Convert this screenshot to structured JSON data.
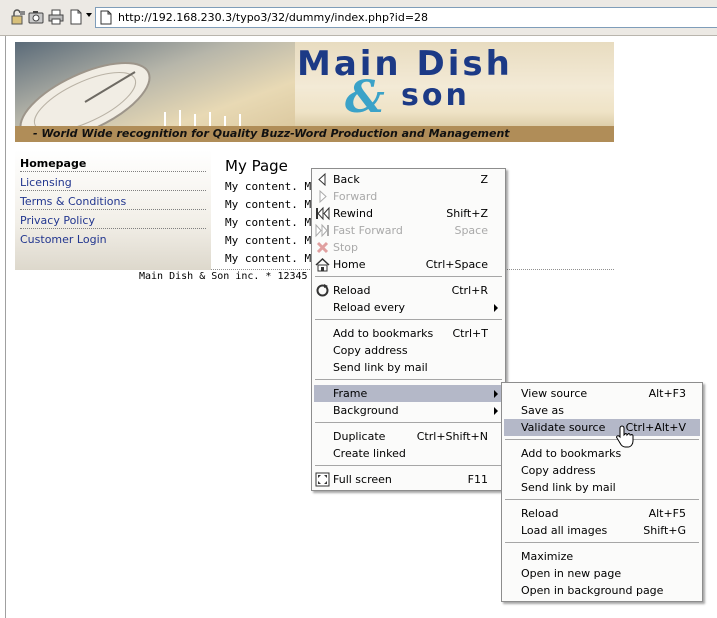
{
  "toolbar": {
    "address_url": "http://192.168.230.3/typo3/32/dummy/index.php?id=28",
    "icons": [
      "security-lock-icon",
      "camera-icon",
      "print-icon",
      "page-icon",
      "dropdown-arrow-icon"
    ]
  },
  "banner": {
    "title_main": "Main Dish",
    "title_amp": "&",
    "title_son": "son",
    "tagline": "- World Wide recognition for Quality Buzz-Word Production and Management"
  },
  "sidebar": {
    "items": [
      {
        "label": "Homepage",
        "active": true
      },
      {
        "label": "Licensing",
        "active": false
      },
      {
        "label": "Terms & Conditions",
        "active": false
      },
      {
        "label": "Privacy Policy",
        "active": false
      },
      {
        "label": "Customer Login",
        "active": false
      }
    ]
  },
  "content": {
    "title": "My Page",
    "lines": [
      "My content. My",
      "My content. My",
      "My content. My",
      "My content. My",
      "My content. My"
    ],
    "footer": "Main Dish & Son inc. * 12345 T"
  },
  "context_menu": {
    "items": [
      {
        "label": "Back",
        "shortcut": "Z",
        "icon": "back-icon",
        "disabled": false
      },
      {
        "label": "Forward",
        "shortcut": "",
        "icon": "forward-icon",
        "disabled": true
      },
      {
        "label": "Rewind",
        "shortcut": "Shift+Z",
        "icon": "rewind-icon",
        "disabled": false
      },
      {
        "label": "Fast Forward",
        "shortcut": "Space",
        "icon": "fast-forward-icon",
        "disabled": true
      },
      {
        "label": "Stop",
        "shortcut": "",
        "icon": "stop-icon",
        "disabled": true
      },
      {
        "label": "Home",
        "shortcut": "Ctrl+Space",
        "icon": "home-icon",
        "disabled": false
      },
      {
        "label": "Reload",
        "shortcut": "Ctrl+R",
        "icon": "reload-icon",
        "disabled": false
      },
      {
        "label": "Reload every",
        "shortcut": "",
        "submenu": true
      },
      {
        "label": "Add to bookmarks",
        "shortcut": "Ctrl+T"
      },
      {
        "label": "Copy address",
        "shortcut": ""
      },
      {
        "label": "Send link by mail",
        "shortcut": ""
      },
      {
        "label": "Frame",
        "shortcut": "",
        "submenu": true,
        "highlighted": true
      },
      {
        "label": "Background",
        "shortcut": "",
        "submenu": true
      },
      {
        "label": "Duplicate",
        "shortcut": "Ctrl+Shift+N"
      },
      {
        "label": "Create linked",
        "shortcut": ""
      },
      {
        "label": "Full screen",
        "shortcut": "F11",
        "icon": "full-screen-icon"
      }
    ]
  },
  "frame_submenu": {
    "items": [
      {
        "label": "View source",
        "shortcut": "Alt+F3"
      },
      {
        "label": "Save as",
        "shortcut": ""
      },
      {
        "label": "Validate source",
        "shortcut": "Ctrl+Alt+V",
        "highlighted": true
      },
      {
        "label": "Add to bookmarks",
        "shortcut": ""
      },
      {
        "label": "Copy address",
        "shortcut": ""
      },
      {
        "label": "Send link by mail",
        "shortcut": ""
      },
      {
        "label": "Reload",
        "shortcut": "Alt+F5"
      },
      {
        "label": "Load all images",
        "shortcut": "Shift+G"
      },
      {
        "label": "Maximize",
        "shortcut": ""
      },
      {
        "label": "Open in new page",
        "shortcut": ""
      },
      {
        "label": "Open in background page",
        "shortcut": ""
      }
    ]
  },
  "colors": {
    "menu_highlight": "#b4b8c8",
    "link": "#22368f",
    "banner_title": "#1c3a86",
    "banner_amp": "#3ba2c8"
  }
}
